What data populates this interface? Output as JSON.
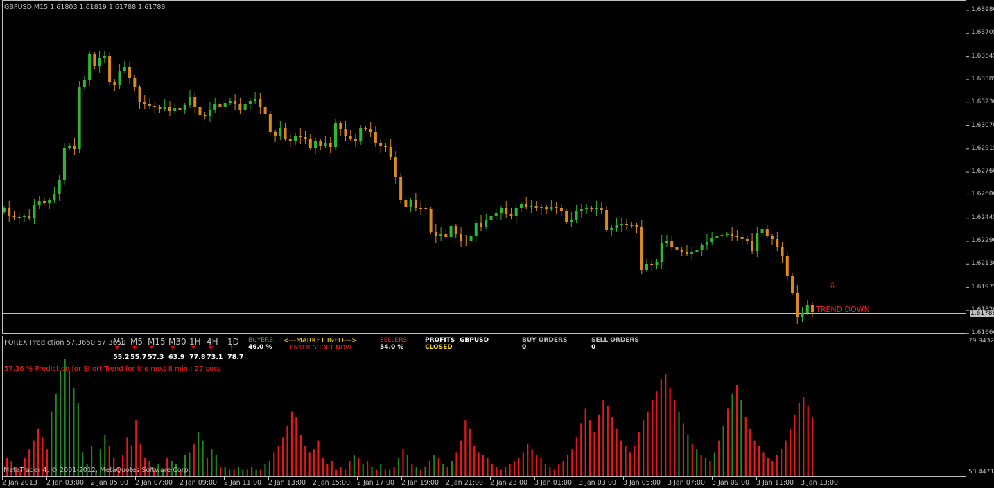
{
  "header": {
    "title": "GBPUSD,M15  1.61803 1.61819 1.61788 1.61788"
  },
  "price_axis": {
    "labels": [
      "1.63980",
      "1.63705",
      "1.63545",
      "1.63385",
      "1.63230",
      "1.63070",
      "1.62915",
      "1.62760",
      "1.62600",
      "1.62445",
      "1.62290",
      "1.62130",
      "1.61975",
      "1.61820",
      "1.61660"
    ],
    "current_price": "1.61788"
  },
  "trend_label": "TREND DOWN",
  "indicator": {
    "title": "FOREX Prediction 57.3650 57.3650",
    "axis_top": "79.9432",
    "axis_bottom": "53.4471",
    "timeframes": [
      {
        "name": "M1",
        "value": "55.2",
        "dir": "down"
      },
      {
        "name": "M5",
        "value": "55.7",
        "dir": "down"
      },
      {
        "name": "M15",
        "value": "57.3",
        "dir": "down"
      },
      {
        "name": "M30",
        "value": "63.9",
        "dir": "down"
      },
      {
        "name": "1H",
        "value": "77.8",
        "dir": "down"
      },
      {
        "name": "4H",
        "value": "73.1",
        "dir": "down"
      },
      {
        "name": "1D",
        "value": "78.7",
        "dir": "up"
      }
    ],
    "buyers_label": "BUYERS",
    "buyers_value": "46.0 %",
    "market_info_label": "<---MARKET INFO--->",
    "market_info_action": "ENTER SHORT NOW",
    "sellers_label": "SELLERS",
    "sellers_value": "54.0 %",
    "profit_label": "PROFIT$",
    "profit_value": "CLOSED",
    "pair": "GBPUSD",
    "buy_orders_label": "BUY ORDERS",
    "buy_orders_value": "0",
    "sell_orders_label": "SELL ORDERS",
    "sell_orders_value": "0",
    "prediction_text": "57.36 % Prediction for Short Trend for the next 8 min : 27 secs",
    "bars": [
      6,
      5,
      3,
      2,
      6,
      9,
      12,
      16,
      13,
      9,
      22,
      28,
      36,
      40,
      36,
      30,
      25,
      8,
      4,
      10,
      2,
      9,
      14,
      10,
      6,
      3,
      7,
      13,
      10,
      19,
      11,
      6,
      5,
      2,
      4,
      2,
      6,
      5,
      4,
      2,
      7,
      8,
      11,
      15,
      12,
      6,
      9,
      7,
      3,
      3,
      2,
      2,
      3,
      2,
      2,
      3,
      2,
      2,
      4,
      5,
      8,
      10,
      13,
      17,
      22,
      20,
      14,
      10,
      8,
      9,
      12,
      6,
      4,
      5,
      2,
      3,
      2,
      5,
      7,
      6,
      4,
      5,
      3,
      2,
      4,
      2,
      2,
      3,
      6,
      9,
      7,
      4,
      3,
      2,
      3,
      5,
      7,
      6,
      4,
      3,
      5,
      8,
      12,
      19,
      16,
      10,
      8,
      7,
      6,
      4,
      3,
      2,
      3,
      4,
      5,
      6,
      8,
      11,
      9,
      7,
      6,
      4,
      3,
      2,
      4,
      5,
      7,
      9,
      13,
      18,
      23,
      19,
      15,
      21,
      26,
      24,
      20,
      16,
      12,
      10,
      8,
      10,
      15,
      19,
      22,
      26,
      29,
      33,
      35,
      30,
      26,
      22,
      18,
      14,
      11,
      9,
      7,
      6,
      5,
      8,
      12,
      17,
      23,
      28,
      31,
      26,
      20,
      16,
      12,
      10,
      8,
      6,
      5,
      7,
      9,
      12,
      16,
      21,
      25,
      27,
      24,
      20
    ],
    "bar_colors": "mixed"
  },
  "time_axis": {
    "labels": [
      "2 Jan 2013",
      "2 Jan 03:00",
      "2 Jan 05:00",
      "2 Jan 07:00",
      "2 Jan 09:00",
      "2 Jan 11:00",
      "2 Jan 13:00",
      "2 Jan 15:00",
      "2 Jan 17:00",
      "2 Jan 19:00",
      "2 Jan 21:00",
      "2 Jan 23:00",
      "3 Jan 01:00",
      "3 Jan 03:00",
      "3 Jan 05:00",
      "3 Jan 07:00",
      "3 Jan 09:00",
      "3 Jan 11:00",
      "3 Jan 13:00"
    ]
  },
  "footer": {
    "copyright": "MetaTrader 4, © 2001-2012, MetaQuotes Software Corp."
  },
  "colors": {
    "bull": "#2fb82f",
    "bear": "#d98a1a",
    "sell_bar": "#e81818",
    "buy_bar": "#1e8a1e",
    "grid": "#c0c0c0",
    "up_text": "#22c022",
    "down_text": "#ff2020",
    "yellow": "#ffd700"
  }
}
